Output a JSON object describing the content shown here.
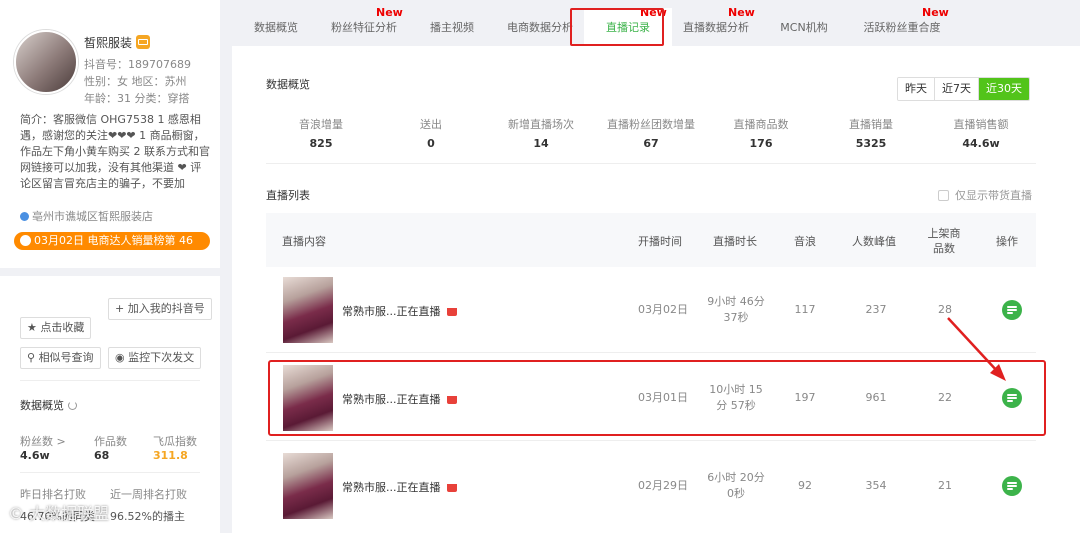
{
  "profile": {
    "name": "皙熙服装",
    "douyin_id": "抖音号：189707689",
    "gender_region": "性别：女   地区：苏州",
    "age_category": "年龄：31   分类：穿搭",
    "bio": "简介：客服微信 OHG7538 1 感恩相遇，感谢您的关注❤❤❤ 1 商品橱窗，作品左下角小黄车购买 2 联系方式和官网链接可以加我，没有其他渠道 ❤ 评论区留言冒充店主的骗子，不要加",
    "location": "亳州市谯城区皙熙服装店",
    "rank": "03月02日 电商达人销量榜第 46",
    "buttons": {
      "favorite": "★ 点击收藏",
      "add_douyin": "+ 加入我的抖音号",
      "similar": "相似号查询",
      "monitor": "监控下次发文"
    },
    "overview_title": "数据概览",
    "stats": [
      {
        "label": "粉丝数 >",
        "value": "4.6w"
      },
      {
        "label": "作品数",
        "value": "68"
      },
      {
        "label": "飞瓜指数",
        "value": "311.8"
      }
    ],
    "rank_daily_label": "昨日排名打败",
    "rank_daily_value": "46.70%的同类",
    "rank_weekly_label": "近一周排名打败",
    "rank_weekly_value": "96.52%的播主"
  },
  "watermark": "© 大数据联盟",
  "tabs": [
    {
      "label": "数据概览",
      "new": false
    },
    {
      "label": "粉丝特征分析",
      "new": true
    },
    {
      "label": "播主视频",
      "new": false
    },
    {
      "label": "电商数据分析",
      "new": false
    },
    {
      "label": "直播记录",
      "new": true
    },
    {
      "label": "直播数据分析",
      "new": true
    },
    {
      "label": "MCN机构",
      "new": false
    },
    {
      "label": "活跃粉丝重合度",
      "new": true
    }
  ],
  "new_label": "New",
  "overview": {
    "title": "数据概览",
    "range": [
      "昨天",
      "近7天",
      "近30天"
    ],
    "active_range": "近30天",
    "kpis": [
      {
        "label": "音浪增量",
        "value": "825"
      },
      {
        "label": "送出",
        "value": "0"
      },
      {
        "label": "新增直播场次",
        "value": "14"
      },
      {
        "label": "直播粉丝团数增量",
        "value": "67"
      },
      {
        "label": "直播商品数",
        "value": "176"
      },
      {
        "label": "直播销量",
        "value": "5325"
      },
      {
        "label": "直播销售额",
        "value": "44.6w"
      }
    ]
  },
  "live_list": {
    "title": "直播列表",
    "checkbox_label": "仅显示带货直播",
    "headers": {
      "content": "直播内容",
      "start": "开播时间",
      "duration": "直播时长",
      "yinlang": "音浪",
      "peak": "人数峰值",
      "goods": "上架商品数",
      "action": "操作"
    },
    "rows": [
      {
        "title": "常熟市服...正在直播",
        "date": "03月02日",
        "duration": "9小时 46分 37秒",
        "yinlang": "117",
        "peak": "237",
        "goods": "28"
      },
      {
        "title": "常熟市服...正在直播",
        "date": "03月01日",
        "duration": "10小时 15分 57秒",
        "yinlang": "197",
        "peak": "961",
        "goods": "22"
      },
      {
        "title": "常熟市服...正在直播",
        "date": "02月29日",
        "duration": "6小时 20分 0秒",
        "yinlang": "92",
        "peak": "354",
        "goods": "21"
      }
    ]
  },
  "colors": {
    "accent": "#3cb34a",
    "highlight": "#e02020",
    "rank": "#ff8a00",
    "value_orange": "#f5a623"
  }
}
